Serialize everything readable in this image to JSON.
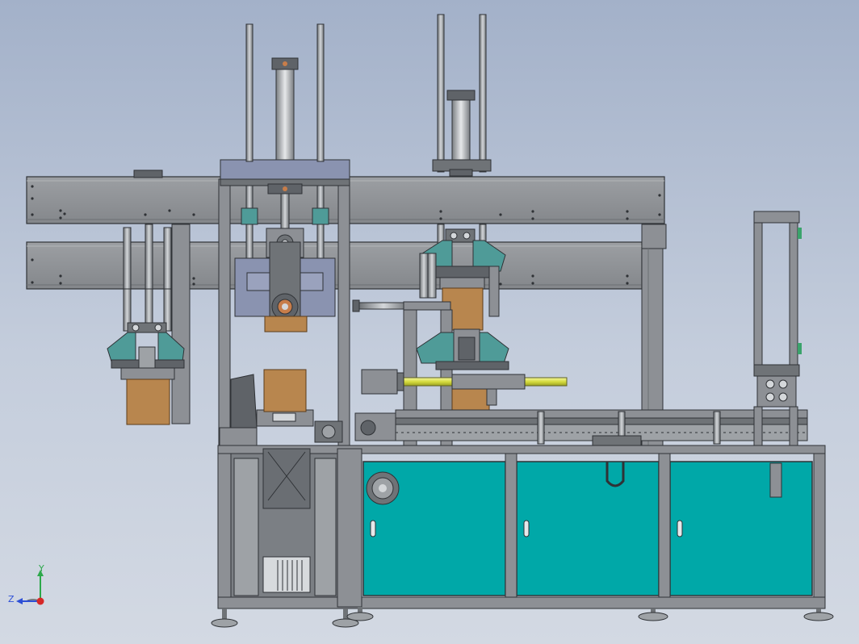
{
  "viewport": {
    "background_top": "#a3b1c9",
    "background_bottom": "#d3d9e3"
  },
  "colors": {
    "frame_steel": "#8d9095",
    "frame_dark": "#5f6368",
    "frame_outline": "#2f3236",
    "panel_teal": "#00a8a8",
    "panel_teal_dark": "#008a8c",
    "cardboard": "#b8864e",
    "highlight_yellow": "#e7ec6a",
    "bracket_teal": "#4f9b98",
    "hub_orange": "#c77d4a"
  },
  "triad": {
    "y_label": "Y",
    "z_label": "Z",
    "icon": "coordinate-triad-icon"
  }
}
